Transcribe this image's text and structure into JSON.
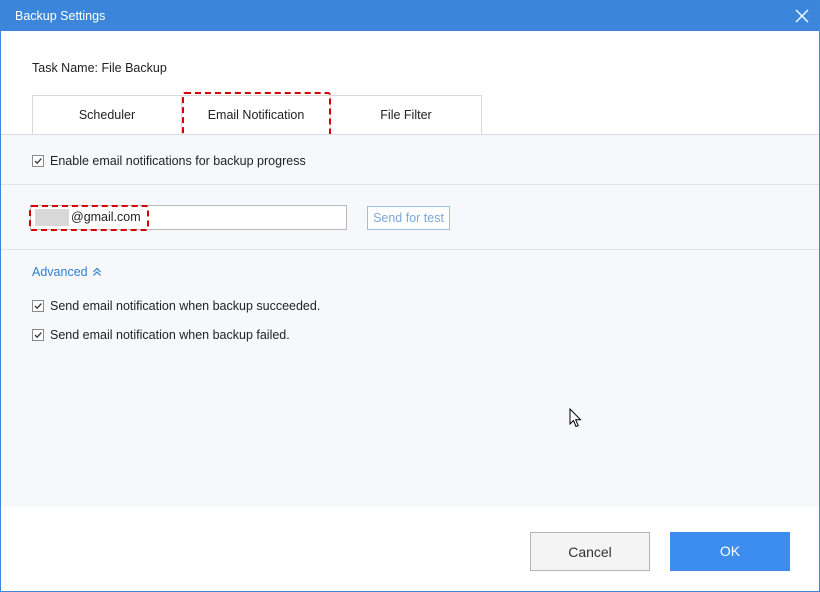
{
  "window": {
    "title": "Backup Settings",
    "close_icon": "close-icon"
  },
  "task": {
    "label": "Task Name:",
    "value": "File Backup"
  },
  "tabs": [
    {
      "label": "Scheduler"
    },
    {
      "label": "Email Notification",
      "active": true
    },
    {
      "label": "File Filter"
    }
  ],
  "email_settings": {
    "enable_label": "Enable email notifications for backup progress",
    "enable_checked": true,
    "email_visible_value": "@gmail.com",
    "send_test_label": "Send for test",
    "advanced_label": "Advanced",
    "advanced_icon": "double-chevron-up-icon",
    "succeeded_label": "Send email notification when backup succeeded.",
    "succeeded_checked": true,
    "failed_label": "Send email notification when backup failed.",
    "failed_checked": true
  },
  "footer": {
    "cancel_label": "Cancel",
    "ok_label": "OK"
  },
  "colors": {
    "titlebar": "#3b86da",
    "accent_link": "#2f7fd0",
    "ok_button": "#3d8df0",
    "highlight_dash": "#d40000",
    "panel_background": "#f6f8fc"
  }
}
